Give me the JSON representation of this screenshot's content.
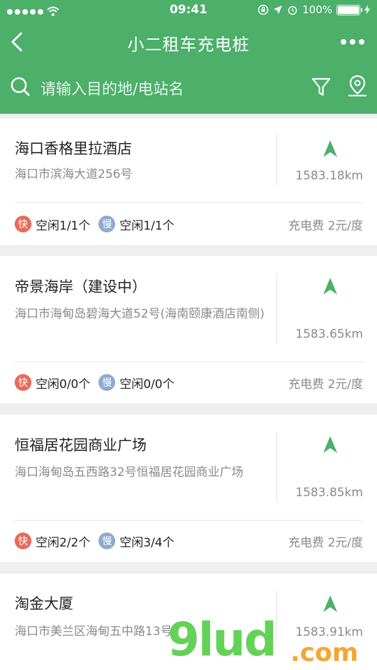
{
  "status": {
    "time": "09:41",
    "battery": "100%"
  },
  "header": {
    "title": "小二租车充电桩"
  },
  "search": {
    "placeholder": "请输入目的地/电站名"
  },
  "labels": {
    "fast": "快",
    "slow": "慢"
  },
  "stations": [
    {
      "name": "海口香格里拉酒店",
      "address": "海口市滨海大道256号",
      "distance": "1583.18km",
      "fast": "空闲1/1个",
      "slow": "空闲1/1个",
      "fee": "充电费 2元/度"
    },
    {
      "name": "帝景海岸（建设中）",
      "address": "海口市海甸岛碧海大道52号(海南颐康酒店南侧)",
      "distance": "1583.65km",
      "fast": "空闲0/0个",
      "slow": "空闲0/0个",
      "fee": "充电费 2元/度"
    },
    {
      "name": "恒福居花园商业广场",
      "address": "海口海甸岛五西路32号恒福居花园商业广场",
      "distance": "1583.85km",
      "fast": "空闲2/2个",
      "slow": "空闲3/4个",
      "fee": "充电费 2元/度"
    },
    {
      "name": "淘金大厦",
      "address": "海口市美兰区海甸五中路13号",
      "distance": "1583.91km"
    }
  ],
  "watermark": {
    "main": "9lud",
    "suffix": ".com"
  },
  "colors": {
    "brand": "#4caf6a",
    "fast": "#e86a5a",
    "slow": "#8fa9cf",
    "arrow": "#4caf6a"
  }
}
